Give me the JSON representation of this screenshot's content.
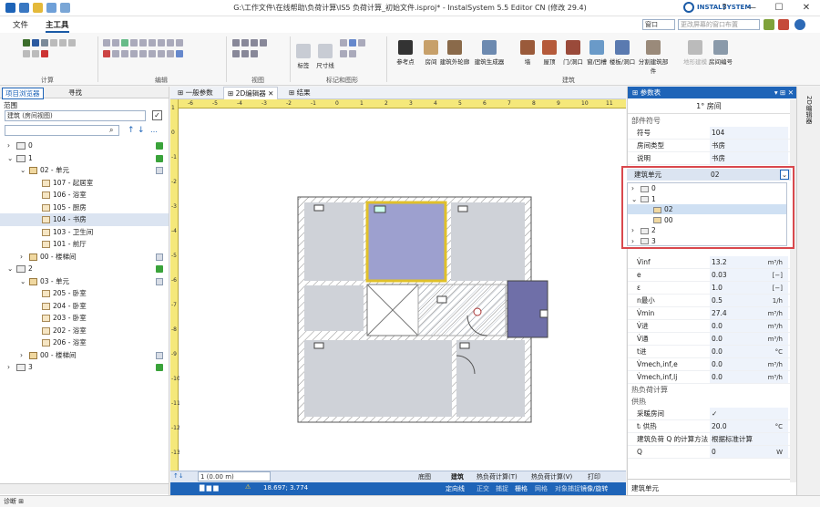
{
  "titlebar": {
    "title": "G:\\工作文件\\在线帮助\\负荷计算\\IS5 负荷计算_初始文件.isproj* - InstalSystem 5.5 Editor CN (修改 29.4)",
    "logo": "INSTALSYSTEM"
  },
  "menubar": {
    "file": "文件",
    "main": "主工具",
    "window_label": "窗口",
    "window_combo": "更改屏幕的窗口布置"
  },
  "ribbon": {
    "groups": {
      "calc": "计算",
      "edit": "编辑",
      "view": "视图",
      "dim": "标记和图形",
      "building": "建筑"
    },
    "dim_buttons": [
      "标签",
      "尺寸线"
    ],
    "building_buttons": [
      "参考点",
      "房间",
      "建筑外轮廓",
      "建筑生成器",
      "墙",
      "屋顶",
      "门/洞口",
      "窗/凹槽",
      "楼板/洞口",
      "分割建筑部件",
      "地形建模",
      "房间编号"
    ]
  },
  "left": {
    "tab1": "项目浏览器",
    "tab2": "寻找",
    "scope_label": "范围",
    "scope_value": "建筑 (房间视图)",
    "tree": [
      {
        "label": "0",
        "indent": 0,
        "type": "lvl",
        "exp": "›"
      },
      {
        "label": "1",
        "indent": 0,
        "type": "lvl",
        "exp": "⌄"
      },
      {
        "label": "02 - 单元",
        "indent": 1,
        "type": "unit",
        "exp": "⌄"
      },
      {
        "label": "107 - 起居室",
        "indent": 2,
        "type": "room"
      },
      {
        "label": "106 - 浴室",
        "indent": 2,
        "type": "room"
      },
      {
        "label": "105 - 厨房",
        "indent": 2,
        "type": "room"
      },
      {
        "label": "104 - 书房",
        "indent": 2,
        "type": "room",
        "sel": true
      },
      {
        "label": "103 - 卫生间",
        "indent": 2,
        "type": "room"
      },
      {
        "label": "101 - 前厅",
        "indent": 2,
        "type": "room"
      },
      {
        "label": "00 - 楼梯间",
        "indent": 1,
        "type": "unit",
        "exp": "›"
      },
      {
        "label": "2",
        "indent": 0,
        "type": "lvl",
        "exp": "⌄"
      },
      {
        "label": "03 - 单元",
        "indent": 1,
        "type": "unit",
        "exp": "⌄"
      },
      {
        "label": "205 - 卧室",
        "indent": 2,
        "type": "room"
      },
      {
        "label": "204 - 卧室",
        "indent": 2,
        "type": "room"
      },
      {
        "label": "203 - 卧室",
        "indent": 2,
        "type": "room"
      },
      {
        "label": "202 - 浴室",
        "indent": 2,
        "type": "room"
      },
      {
        "label": "206 - 浴室",
        "indent": 2,
        "type": "room"
      },
      {
        "label": "00 - 楼梯间",
        "indent": 1,
        "type": "unit",
        "exp": "›"
      },
      {
        "label": "3",
        "indent": 0,
        "type": "lvl",
        "exp": "›"
      }
    ]
  },
  "center": {
    "tabs": [
      "一般参数",
      "2D编辑器",
      "结果"
    ],
    "ruler_h": [
      "-6",
      "-5",
      "-4",
      "-3",
      "-2",
      "-1",
      "0",
      "1",
      "2",
      "3",
      "4",
      "5",
      "6",
      "7",
      "8",
      "9",
      "10",
      "11"
    ],
    "ruler_v": [
      "1",
      "0",
      "-1",
      "-2",
      "-3",
      "-4",
      "-5",
      "-6",
      "-7",
      "-8",
      "-9",
      "-10",
      "-11",
      "-12",
      "-13"
    ],
    "level": "1 (0.00 m)",
    "status_buttons": [
      "底图",
      "建筑",
      "热负荷计算(T)",
      "热负荷计算(V)",
      "打印"
    ],
    "coords": "18.697; 3.774",
    "status_items": [
      "正交",
      "捕捉",
      "栅格",
      "网格",
      "对象捕捉",
      "追踪",
      "偏移",
      "镜像/旋转"
    ],
    "status_dirs": "定向线",
    "mirror": "镜像/旋转"
  },
  "right": {
    "title": "参数表",
    "room": "1° 房间",
    "sec1": "部件符号",
    "rows1": [
      {
        "k": "符号",
        "v": "104"
      },
      {
        "k": "房间类型",
        "v": "书房"
      },
      {
        "k": "说明",
        "v": "书房"
      }
    ],
    "combo_label": "建筑单元",
    "combo_value": "02",
    "dropdown": [
      {
        "t": "0",
        "lvl": 0,
        "exp": "›"
      },
      {
        "t": "1",
        "lvl": 0,
        "exp": "⌄"
      },
      {
        "t": "02",
        "lvl": 1,
        "sel": true
      },
      {
        "t": "00",
        "lvl": 1
      },
      {
        "t": "2",
        "lvl": 0,
        "exp": "›"
      },
      {
        "t": "3",
        "lvl": 0,
        "exp": "›"
      }
    ],
    "rows2": [
      {
        "k": "V̇inf",
        "v": "13.2",
        "u": "m³/h"
      },
      {
        "k": "e",
        "v": "0.03",
        "u": "[−]"
      },
      {
        "k": "ε",
        "v": "1.0",
        "u": "[−]"
      },
      {
        "k": "n最小",
        "v": "0.5",
        "u": "1/h"
      },
      {
        "k": "V̇min",
        "v": "27.4",
        "u": "m³/h"
      },
      {
        "k": "V̇进",
        "v": "0.0",
        "u": "m³/h"
      },
      {
        "k": "V̇通",
        "v": "0.0",
        "u": "m³/h"
      },
      {
        "k": "t进",
        "v": "0.0",
        "u": "°C"
      },
      {
        "k": "V̇mech,inf,e",
        "v": "0.0",
        "u": "m³/h"
      },
      {
        "k": "V̇mech,inf,lj",
        "v": "0.0",
        "u": "m³/h"
      }
    ],
    "sec2": "热负荷计算",
    "sec3": "供热",
    "rows3": [
      {
        "k": "采暖房间",
        "v": "✓"
      },
      {
        "k": "tᵢ 供热",
        "v": "20.0",
        "u": "°C"
      },
      {
        "k": "建筑负荷 Q 的计算方法",
        "v": "根据标准计算"
      },
      {
        "k": "Q",
        "v": "0",
        "u": "W"
      }
    ],
    "footer": "建筑单元",
    "side": "2D编辑器"
  },
  "bottom": {
    "text": "诊断 ⊞"
  },
  "colors": {
    "accent": "#1e64b8",
    "highlight": "#d9484d",
    "selected_room": "#8a8fc6",
    "yellow": "#e0c02a"
  }
}
